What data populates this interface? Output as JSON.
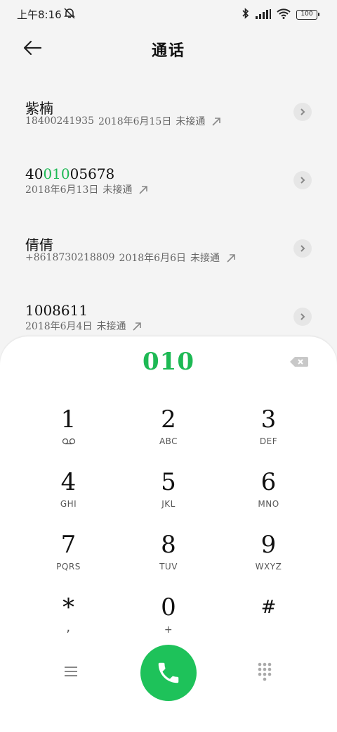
{
  "status_bar": {
    "time": "上午8:16",
    "battery": "100",
    "icons": [
      "mute-icon",
      "bluetooth-icon",
      "signal-icon",
      "wifi-icon",
      "battery-icon"
    ]
  },
  "header": {
    "title": "通话",
    "back_icon": "arrow-left-icon"
  },
  "calls": [
    {
      "name_parts": [
        "紫楠",
        "",
        ""
      ],
      "number": "18400241935",
      "date": "2018年6月15日",
      "status": "未接通"
    },
    {
      "name_parts": [
        "40",
        "010",
        "05678"
      ],
      "number": "",
      "date": "2018年6月13日",
      "status": "未接通"
    },
    {
      "name_parts": [
        "倩倩",
        "",
        ""
      ],
      "number": "+8618730218809",
      "date": "2018年6月6日",
      "status": "未接通"
    },
    {
      "name_parts": [
        "1008611",
        "",
        ""
      ],
      "number": "",
      "date": "2018年6月4日",
      "status": "未接通"
    }
  ],
  "dialpad": {
    "input": "010",
    "keys": [
      {
        "digit": "1",
        "sub": ""
      },
      {
        "digit": "2",
        "sub": "ABC"
      },
      {
        "digit": "3",
        "sub": "DEF"
      },
      {
        "digit": "4",
        "sub": "GHI"
      },
      {
        "digit": "5",
        "sub": "JKL"
      },
      {
        "digit": "6",
        "sub": "MNO"
      },
      {
        "digit": "7",
        "sub": "PQRS"
      },
      {
        "digit": "8",
        "sub": "TUV"
      },
      {
        "digit": "9",
        "sub": "WXYZ"
      },
      {
        "digit": "*",
        "sub": ","
      },
      {
        "digit": "0",
        "sub": "+"
      },
      {
        "digit": "#",
        "sub": ""
      }
    ],
    "voicemail_icon": "voicemail-icon"
  },
  "colors": {
    "accent": "#1db954",
    "call_button": "#1ec25a",
    "background": "#f4f4f4"
  }
}
